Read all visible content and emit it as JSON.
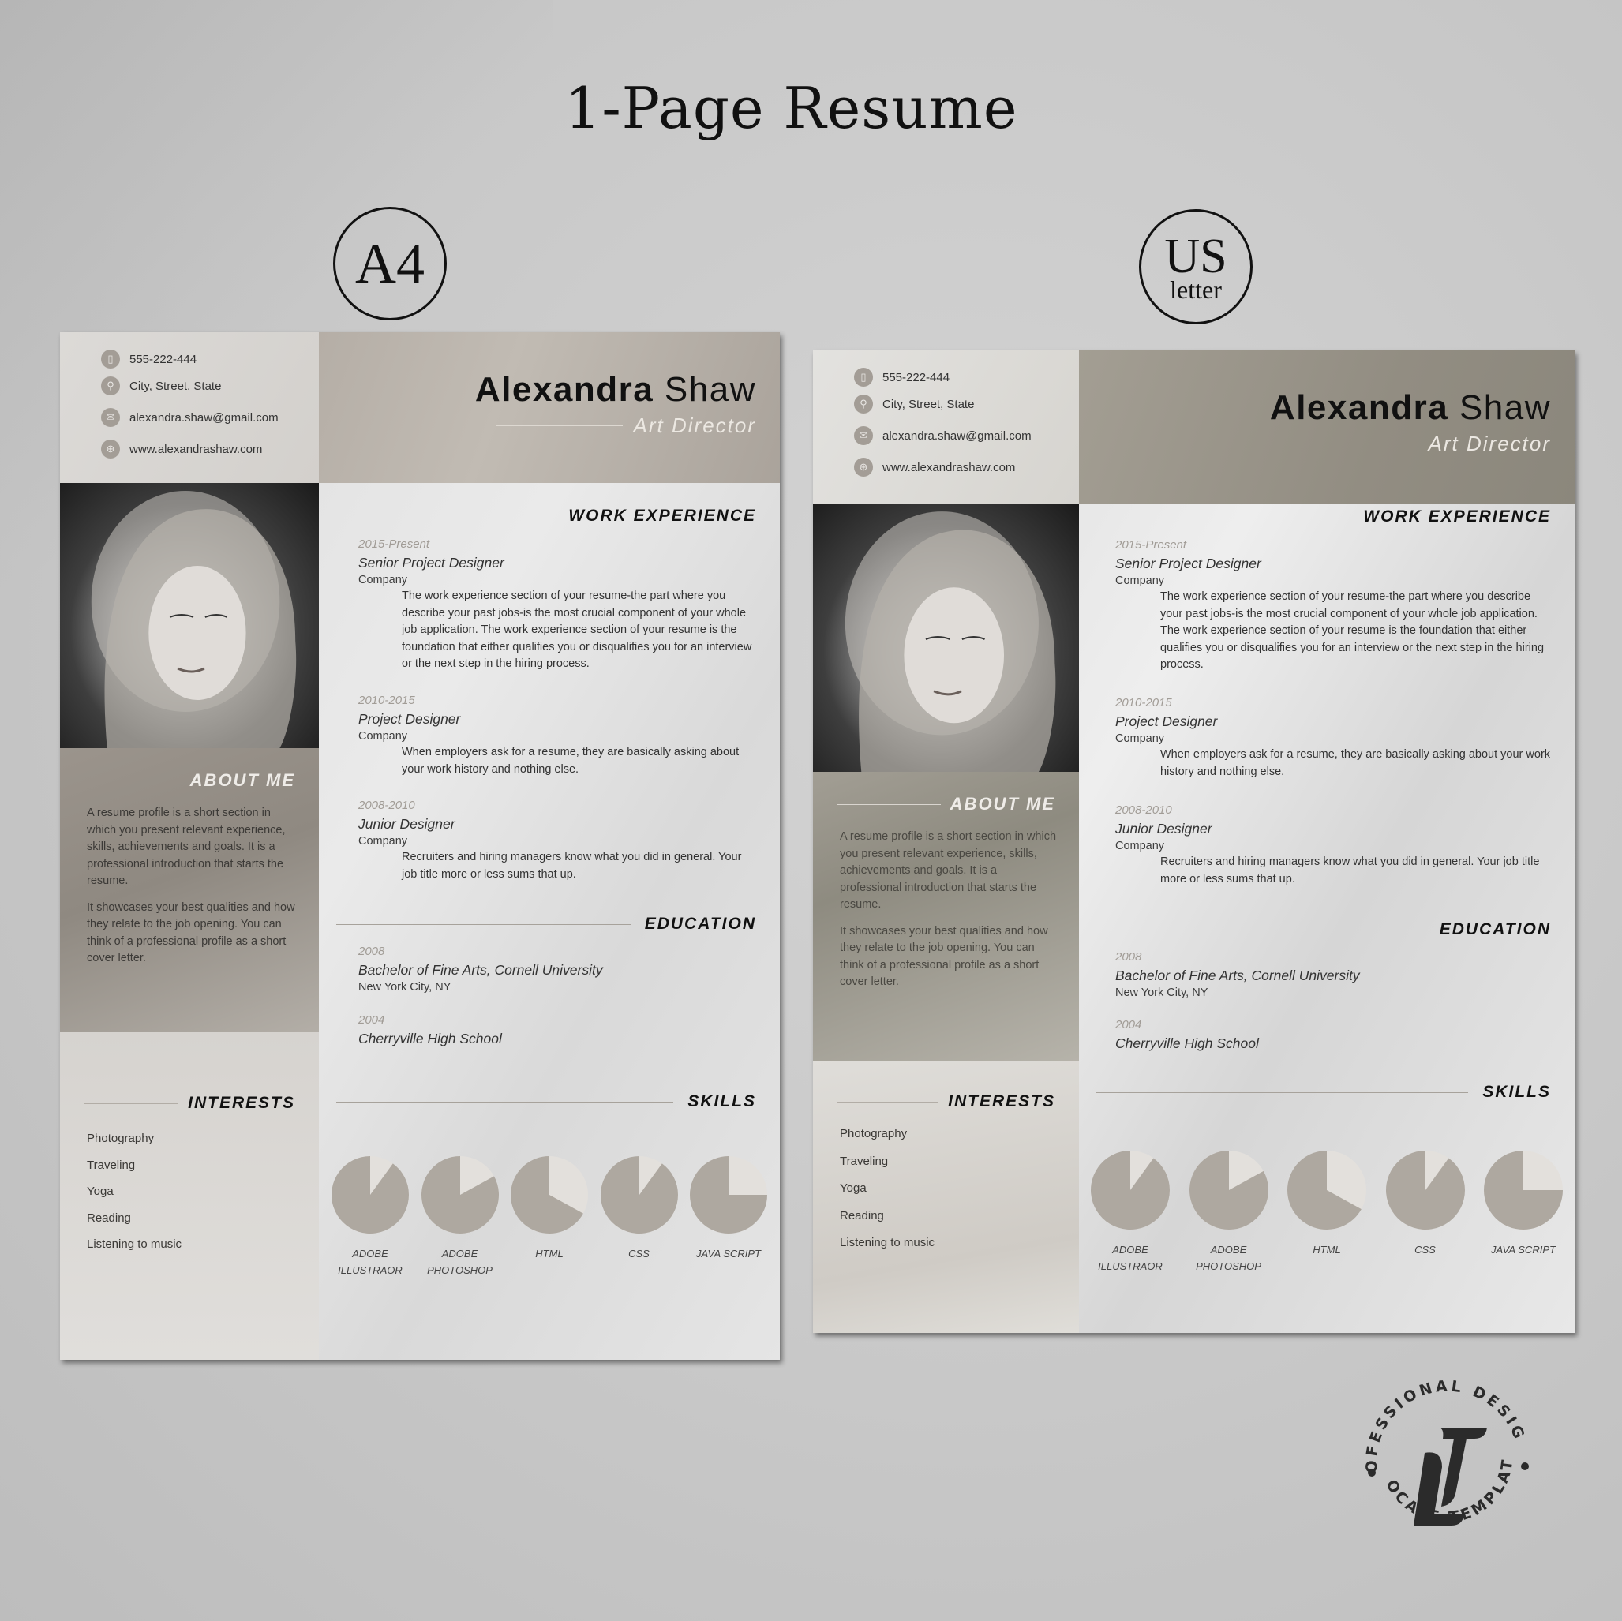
{
  "heading": "1-Page Resume",
  "formats": [
    {
      "label": "A4"
    },
    {
      "label_main": "US",
      "label_sub": "letter"
    }
  ],
  "resume": {
    "name_first": "Alexandra",
    "name_last": "Shaw",
    "role": "Art Director",
    "contact": [
      {
        "icon": "phone-icon",
        "glyph": "▯",
        "text": "555-222-444"
      },
      {
        "icon": "location-pin-icon",
        "glyph": "⚲",
        "text": "City, Street, State"
      },
      {
        "icon": "envelope-icon",
        "glyph": "✉",
        "text": "alexandra.shaw@gmail.com"
      },
      {
        "icon": "globe-icon",
        "glyph": "⊕",
        "text": "www.alexandrashaw.com"
      }
    ],
    "about": {
      "heading": "ABOUT ME",
      "paragraphs": [
        "A resume profile is a short section in which you present relevant experience, skills, achievements and goals. It is a professional introduction that starts the resume.",
        "It showcases your best qualities and how they relate to the job opening. You can think of a professional profile as a short cover letter."
      ]
    },
    "interests": {
      "heading": "INTERESTS",
      "items": [
        "Photography",
        "Traveling",
        "Yoga",
        "Reading",
        "Listening to music"
      ]
    },
    "work": {
      "heading": "WORK EXPERIENCE",
      "jobs": [
        {
          "date": "2015-Present",
          "title": "Senior Project Designer",
          "company": "Company",
          "desc": "The work experience section of your resume-the part where you describe your past jobs-is the most crucial component of your whole job application. The work experience section of your resume is the foundation that either qualifies you or disqualifies you for an interview or the next step in the hiring process."
        },
        {
          "date": "2010-2015",
          "title": "Project Designer",
          "company": "Company",
          "desc": "When employers ask for a resume, they are basically asking about your work history and nothing else."
        },
        {
          "date": "2008-2010",
          "title": "Junior Designer",
          "company": "Company",
          "desc": "Recruiters and hiring managers know what you did in general. Your job title more or less sums that up."
        }
      ]
    },
    "education": {
      "heading": "EDUCATION",
      "entries": [
        {
          "date": "2008",
          "title": "Bachelor of Fine Arts, Cornell University",
          "place": "New York City, NY"
        },
        {
          "date": "2004",
          "title": "Cherryville High School",
          "place": ""
        }
      ]
    },
    "skills": {
      "heading": "SKILLS",
      "items": [
        {
          "line1": "ADOBE",
          "line2": "ILLUSTRAOR",
          "level_pct": 90
        },
        {
          "line1": "ADOBE",
          "line2": "PHOTOSHOP",
          "level_pct": 83
        },
        {
          "line1": "HTML",
          "line2": "",
          "level_pct": 67
        },
        {
          "line1": "CSS",
          "line2": "",
          "level_pct": 90
        },
        {
          "line1": "JAVA SCRIPT",
          "line2": "",
          "level_pct": 75
        }
      ]
    }
  },
  "brand": {
    "top_arc": "PROFESSIONAL DESIGNS",
    "bottom_arc": "LOCATE TEMPLATE",
    "monogram": "LT"
  },
  "colors": {
    "skill_fill": "#aea8a0",
    "skill_remaining": "#e3e0dc",
    "accent_taupe": "#9b948c"
  }
}
